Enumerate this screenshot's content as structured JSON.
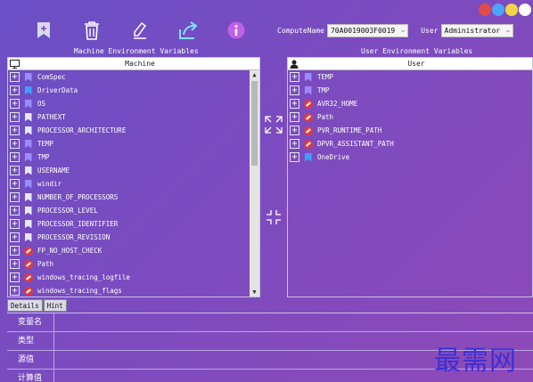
{
  "window_dots": [
    "#e04b4b",
    "#4da3ff",
    "#f0d54a",
    "#ffffff"
  ],
  "toolbar": [
    {
      "name": "bookmark-icon"
    },
    {
      "name": "trash-icon"
    },
    {
      "name": "edit-icon"
    },
    {
      "name": "share-icon"
    },
    {
      "name": "info-icon"
    }
  ],
  "compute_name": {
    "label": "ComputeName",
    "value": "70A0019003F0019"
  },
  "user_select": {
    "label": "User",
    "value": "Administrator"
  },
  "machine_panel": {
    "title": "Machine Environment Variables",
    "column": "Machine",
    "items": [
      {
        "label": "ComSpec",
        "icon": "p"
      },
      {
        "label": "DriverData",
        "icon": "b"
      },
      {
        "label": "OS",
        "icon": "p"
      },
      {
        "label": "PATHEXT",
        "icon": "w"
      },
      {
        "label": "PROCESSOR_ARCHITECTURE",
        "icon": "w"
      },
      {
        "label": "TEMP",
        "icon": "p"
      },
      {
        "label": "TMP",
        "icon": "p"
      },
      {
        "label": "USERNAME",
        "icon": "w"
      },
      {
        "label": "windir",
        "icon": "p"
      },
      {
        "label": "NUMBER_OF_PROCESSORS",
        "icon": "w"
      },
      {
        "label": "PROCESSOR_LEVEL",
        "icon": "w"
      },
      {
        "label": "PROCESSOR_IDENTIFIER",
        "icon": "w"
      },
      {
        "label": "PROCESSOR_REVISION",
        "icon": "w"
      },
      {
        "label": "FP_NO_HOST_CHECK",
        "icon": "no"
      },
      {
        "label": "Path",
        "icon": "no"
      },
      {
        "label": "windows_tracing_logfile",
        "icon": "no"
      },
      {
        "label": "windows_tracing_flags",
        "icon": "no"
      }
    ]
  },
  "user_panel": {
    "title": "User Environment Variables",
    "column": "User",
    "items": [
      {
        "label": "TEMP",
        "icon": "p"
      },
      {
        "label": "TMP",
        "icon": "p"
      },
      {
        "label": "AVR32_HOME",
        "icon": "no"
      },
      {
        "label": "Path",
        "icon": "no"
      },
      {
        "label": "PVR_RUNTIME_PATH",
        "icon": "no"
      },
      {
        "label": "DPVR_ASSISTANT_PATH",
        "icon": "no"
      },
      {
        "label": "OneDrive",
        "icon": "b"
      }
    ]
  },
  "tabs": [
    "Details",
    "Hint"
  ],
  "details": [
    {
      "label": "变量名"
    },
    {
      "label": "类型"
    },
    {
      "label": "源值"
    },
    {
      "label": "计算值"
    }
  ],
  "watermark": "最需网"
}
